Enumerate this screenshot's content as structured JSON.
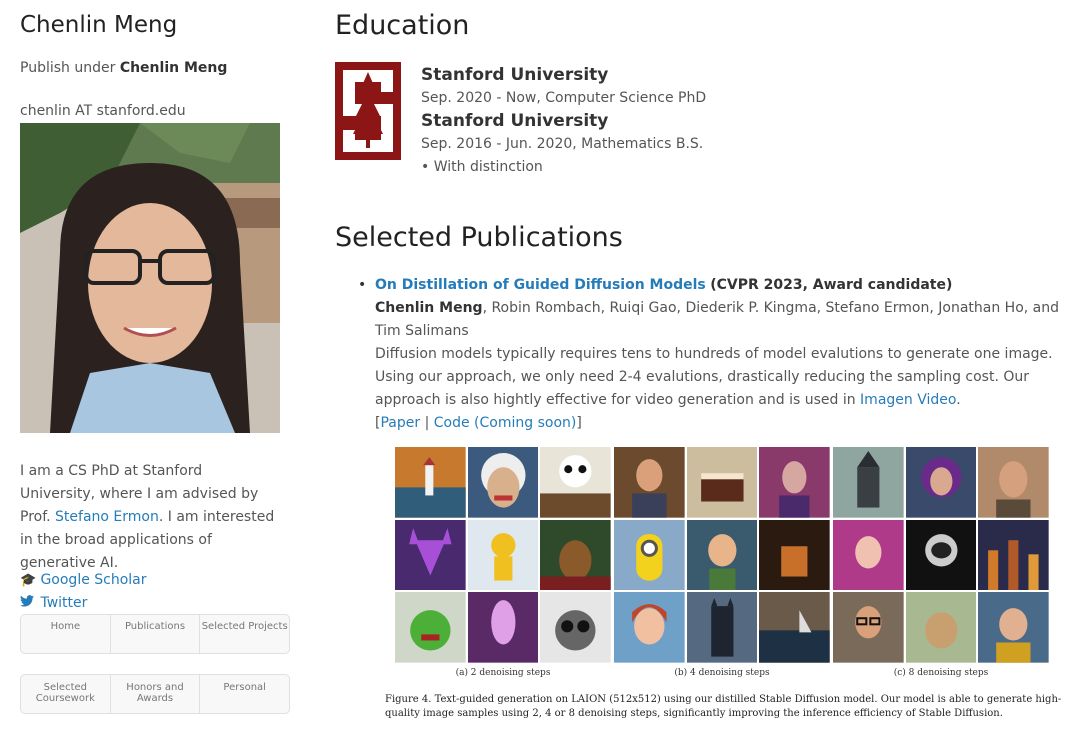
{
  "sidebar": {
    "name": "Chenlin Meng",
    "publish_prefix": "Publish under ",
    "publish_name": "Chenlin Meng",
    "email": "chenlin AT stanford.edu",
    "bio_1": "I am a CS PhD at Stanford University, where I am advised by Prof. ",
    "bio_link": "Stefano Ermon",
    "bio_2": ". I am interested in the broad applications of generative AI.",
    "scholar_label": "Google Scholar",
    "twitter_label": "Twitter",
    "nav_row1": [
      "Home",
      "Publications",
      "Selected Projects"
    ],
    "nav_row2_selected": "Selected Coursework",
    "nav_row2_honors": "Honors and Awards",
    "nav_row2_personal": "Personal"
  },
  "education": {
    "heading": "Education",
    "entries": [
      {
        "school": "Stanford University",
        "detail": "Sep. 2020 - Now, Computer Science PhD"
      },
      {
        "school": "Stanford University",
        "detail": "Sep. 2016 - Jun. 2020, Mathematics B.S.",
        "note": "• With distinction"
      }
    ]
  },
  "publications": {
    "heading": "Selected Publications",
    "items": [
      {
        "title": "On Distillation of Guided Diffusion Models",
        "venue": "(CVPR 2023, Award candidate)",
        "first_author": "Chenlin Meng",
        "coauthors": ", Robin Rombach, Ruiqi Gao, Diederik P. Kingma, Stefano Ermon, Jonathan Ho, and Tim Salimans",
        "abstract": "Diffusion models typically requires tens to hundreds of model evalutions to generate one image. Using our approach, we only need 2-4 evalutions, drastically reducing the sampling cost. Our approach is also hightly effective for video generation and is used in ",
        "abstract_link": "Imagen Video",
        "abstract_end": ".",
        "link_open": "[",
        "paper_label": "Paper",
        "sep": " | ",
        "code_label": "Code (Coming soon)",
        "link_close": "]"
      }
    ]
  },
  "figure": {
    "captions": [
      "(a) 2 denoising steps",
      "(b) 4 denoising steps",
      "(c) 8 denoising steps"
    ],
    "caption": "Figure 4.  Text-guided generation on LAION (512x512) using our distilled Stable Diffusion model. Our model is able to generate high-quality image samples using 2, 4 or 8 denoising steps, significantly improving the inference efficiency of Stable Diffusion."
  },
  "icons": {
    "scholar": "graduation-cap-icon",
    "twitter": "twitter-bird-icon"
  },
  "colors": {
    "link": "#267cb9",
    "stanford_cardinal": "#8c1515"
  }
}
